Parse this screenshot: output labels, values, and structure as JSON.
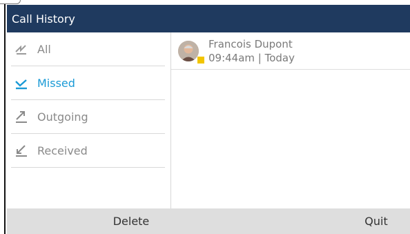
{
  "window": {
    "title": "Call History"
  },
  "filters": [
    {
      "label": "All",
      "icon": "all-calls-icon",
      "selected": false
    },
    {
      "label": "Missed",
      "icon": "missed-call-icon",
      "selected": true
    },
    {
      "label": "Outgoing",
      "icon": "outgoing-call-icon",
      "selected": false
    },
    {
      "label": "Received",
      "icon": "received-call-icon",
      "selected": false
    }
  ],
  "entries": [
    {
      "name": "Francois Dupont",
      "time": "09:44am | Today",
      "presence_color": "#f2c500"
    }
  ],
  "softkeys": {
    "left_label": "Delete",
    "right_label": "Quit"
  },
  "colors": {
    "titlebar": "#1f3a5f",
    "selected_text": "#1a9ad6",
    "unselected_text": "#8a8a8a",
    "softkey_bar": "#dedede"
  }
}
